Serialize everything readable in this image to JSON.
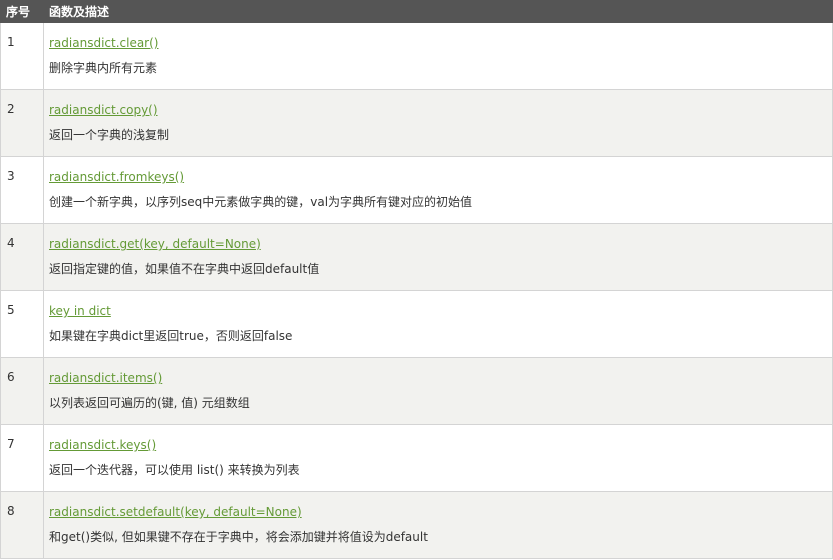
{
  "header": {
    "col_no": "序号",
    "col_desc": "函数及描述"
  },
  "rows": [
    {
      "no": "1",
      "func": "radiansdict.clear()",
      "desc": "删除字典内所有元素"
    },
    {
      "no": "2",
      "func": "radiansdict.copy()",
      "desc": "返回一个字典的浅复制"
    },
    {
      "no": "3",
      "func": "radiansdict.fromkeys()",
      "desc": "创建一个新字典，以序列seq中元素做字典的键，val为字典所有键对应的初始值"
    },
    {
      "no": "4",
      "func": "radiansdict.get(key, default=None)",
      "desc": "返回指定键的值，如果值不在字典中返回default值"
    },
    {
      "no": "5",
      "func": "key in dict",
      "desc": "如果键在字典dict里返回true，否则返回false"
    },
    {
      "no": "6",
      "func": "radiansdict.items()",
      "desc": "以列表返回可遍历的(键, 值) 元组数组"
    },
    {
      "no": "7",
      "func": "radiansdict.keys()",
      "desc": "返回一个迭代器，可以使用 list() 来转换为列表"
    },
    {
      "no": "8",
      "func": "radiansdict.setdefault(key, default=None)",
      "desc": "和get()类似, 但如果键不存在于字典中，将会添加键并将值设为default"
    }
  ],
  "colors": {
    "header_bg": "#555555",
    "link": "#649a36",
    "alt_row_bg": "#f2f2ef"
  }
}
